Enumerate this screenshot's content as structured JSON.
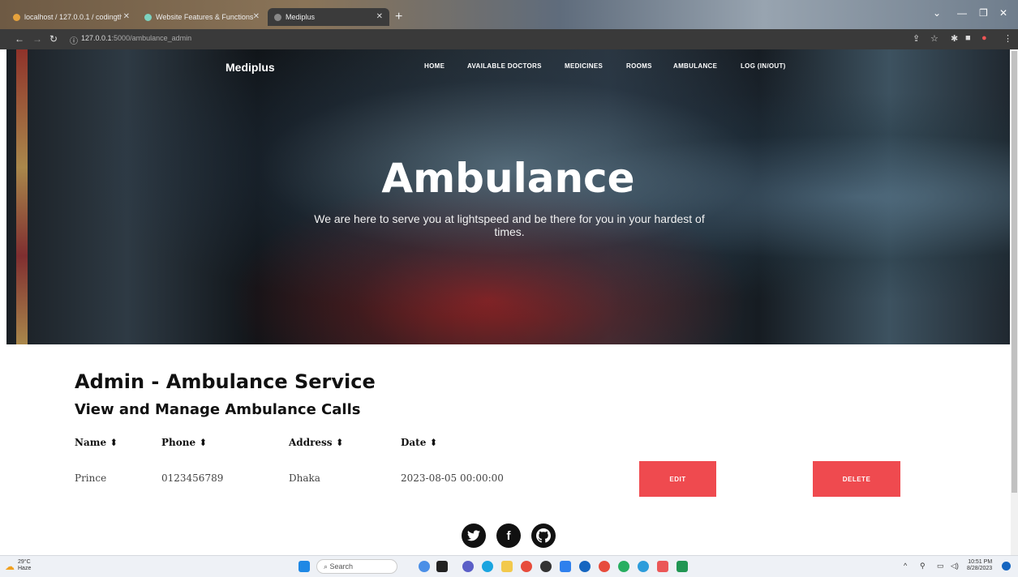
{
  "browser": {
    "tabs": [
      {
        "label": "localhost / 127.0.0.1 / codingth..."
      },
      {
        "label": "Website Features & Functions"
      },
      {
        "label": "Mediplus"
      }
    ],
    "url_host": "127.0.0.1",
    "url_path": ":5000/ambulance_admin"
  },
  "site": {
    "brand": "Mediplus",
    "nav": [
      "HOME",
      "AVAILABLE DOCTORS",
      "MEDICINES",
      "ROOMS",
      "AMBULANCE",
      "LOG (IN/OUT)"
    ]
  },
  "hero": {
    "title": "Ambulance",
    "subtitle": "We are here to serve you at lightspeed and be there for you in your hardest of times."
  },
  "admin": {
    "title": "Admin - Ambulance Service",
    "subtitle": "View and Manage Ambulance Calls",
    "columns": [
      "Name",
      "Phone",
      "Address",
      "Date"
    ],
    "rows": [
      {
        "name": "Prince",
        "phone": "0123456789",
        "address": "Dhaka",
        "date": "2023-08-05 00:00:00"
      }
    ],
    "edit_label": "EDIT",
    "delete_label": "DELETE",
    "accent": "#ef4a4f"
  },
  "footer": {
    "social": [
      "twitter-icon",
      "facebook-icon",
      "github-icon"
    ]
  },
  "taskbar": {
    "weather_temp": "29°C",
    "weather_desc": "Haze",
    "search": "Search",
    "time": "10:51 PM",
    "date": "8/28/2023"
  }
}
